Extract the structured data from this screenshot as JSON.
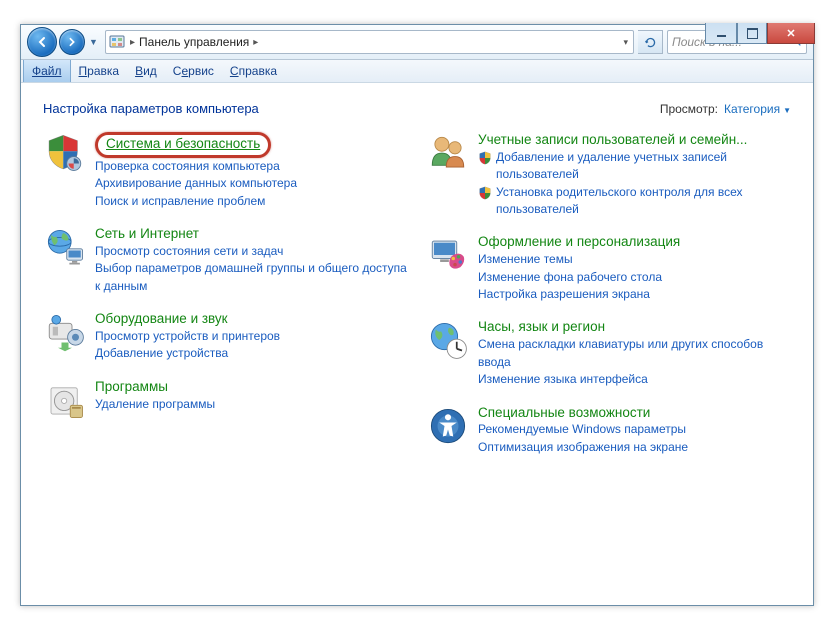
{
  "titlebar": {
    "minimize": "",
    "maximize": "",
    "close": "✕"
  },
  "nav": {
    "address_root": "Панель управления",
    "search_placeholder": "Поиск в па..."
  },
  "menu": {
    "file": "Файл",
    "edit": "Правка",
    "view": "Вид",
    "tools": "Сервис",
    "help": "Справка"
  },
  "content": {
    "heading": "Настройка параметров компьютера",
    "view_label": "Просмотр:",
    "view_value": "Категория"
  },
  "categories_left": [
    {
      "id": "system-security",
      "title": "Система и безопасность",
      "highlighted": true,
      "tasks": [
        {
          "label": "Проверка состояния компьютера",
          "shield": false
        },
        {
          "label": "Архивирование данных компьютера",
          "shield": false
        },
        {
          "label": "Поиск и исправление проблем",
          "shield": false
        }
      ]
    },
    {
      "id": "network-internet",
      "title": "Сеть и Интернет",
      "tasks": [
        {
          "label": "Просмотр состояния сети и задач",
          "shield": false
        },
        {
          "label": "Выбор параметров домашней группы и общего доступа к данным",
          "shield": false
        }
      ]
    },
    {
      "id": "hardware-sound",
      "title": "Оборудование и звук",
      "tasks": [
        {
          "label": "Просмотр устройств и принтеров",
          "shield": false
        },
        {
          "label": "Добавление устройства",
          "shield": false
        }
      ]
    },
    {
      "id": "programs",
      "title": "Программы",
      "tasks": [
        {
          "label": "Удаление программы",
          "shield": false
        }
      ]
    }
  ],
  "categories_right": [
    {
      "id": "user-accounts",
      "title": "Учетные записи пользователей и семейн...",
      "tasks": [
        {
          "label": "Добавление и удаление учетных записей пользователей",
          "shield": true
        },
        {
          "label": "Установка родительского контроля для всех пользователей",
          "shield": true
        }
      ]
    },
    {
      "id": "appearance",
      "title": "Оформление и персонализация",
      "tasks": [
        {
          "label": "Изменение темы",
          "shield": false
        },
        {
          "label": "Изменение фона рабочего стола",
          "shield": false
        },
        {
          "label": "Настройка разрешения экрана",
          "shield": false
        }
      ]
    },
    {
      "id": "clock-language",
      "title": "Часы, язык и регион",
      "tasks": [
        {
          "label": "Смена раскладки клавиатуры или других способов ввода",
          "shield": false
        },
        {
          "label": "Изменение языка интерфейса",
          "shield": false
        }
      ]
    },
    {
      "id": "ease-of-access",
      "title": "Специальные возможности",
      "tasks": [
        {
          "label": "Рекомендуемые Windows параметры",
          "shield": false
        },
        {
          "label": "Оптимизация изображения на экране",
          "shield": false
        }
      ]
    }
  ]
}
